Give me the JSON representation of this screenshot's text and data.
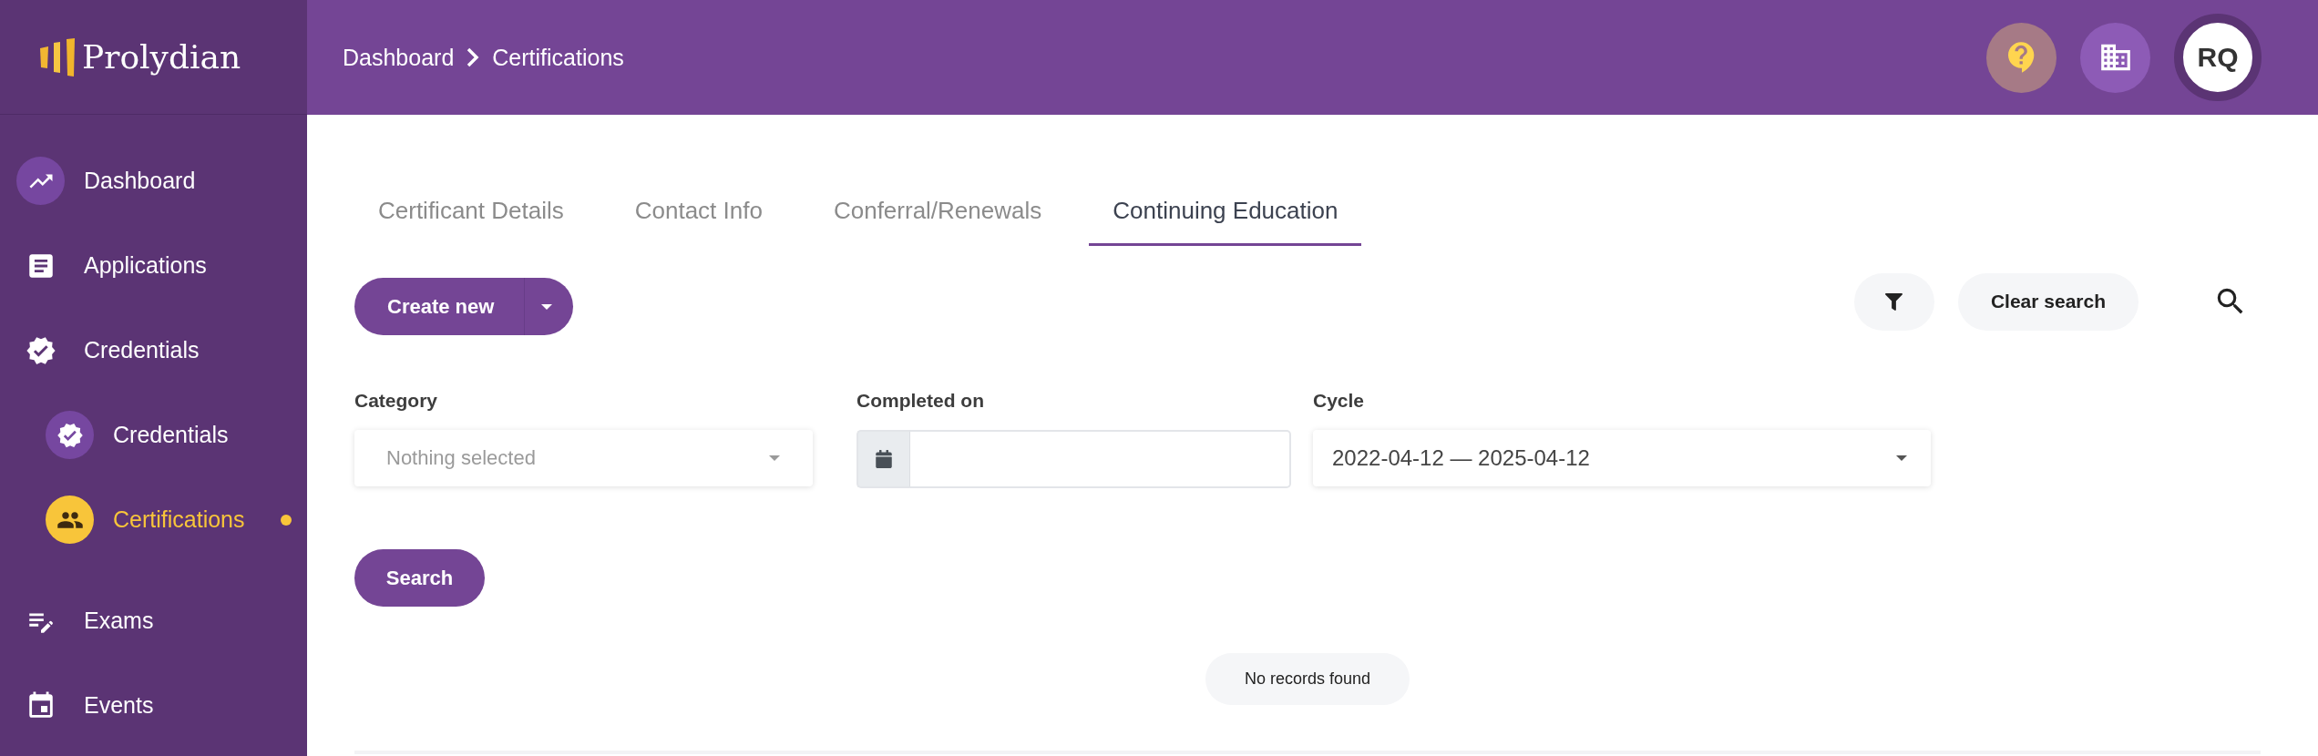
{
  "sidebar": {
    "logo": "Prolydian",
    "items": [
      {
        "label": "Dashboard",
        "kind": "circled",
        "selected": false
      },
      {
        "label": "Applications",
        "kind": "plain",
        "selected": false
      },
      {
        "label": "Credentials",
        "kind": "plain",
        "selected": false,
        "children": [
          {
            "label": "Credentials",
            "kind": "circled",
            "selected": false
          },
          {
            "label": "Certifications",
            "kind": "circled",
            "selected": true
          }
        ]
      },
      {
        "label": "Exams",
        "kind": "plain",
        "selected": false
      },
      {
        "label": "Events",
        "kind": "plain",
        "selected": false
      }
    ]
  },
  "header": {
    "breadcrumb": [
      "Dashboard",
      "Certifications"
    ],
    "avatar": "RQ"
  },
  "tabs": [
    {
      "label": "Certificant Details",
      "selected": false
    },
    {
      "label": "Contact Info",
      "selected": false
    },
    {
      "label": "Conferral/Renewals",
      "selected": false
    },
    {
      "label": "Continuing Education",
      "selected": true
    }
  ],
  "toolbar": {
    "create_button": "Create new",
    "clear_button": "Clear search"
  },
  "filters": [
    {
      "kind": "select",
      "label": "Category",
      "placeholder": "Nothing selected"
    },
    {
      "kind": "date",
      "label": "Completed on"
    },
    {
      "kind": "select",
      "label": "Cycle",
      "value": "2022-04-12 — 2025-04-12"
    }
  ],
  "search_button": "Search",
  "empty_message": "No records found"
}
